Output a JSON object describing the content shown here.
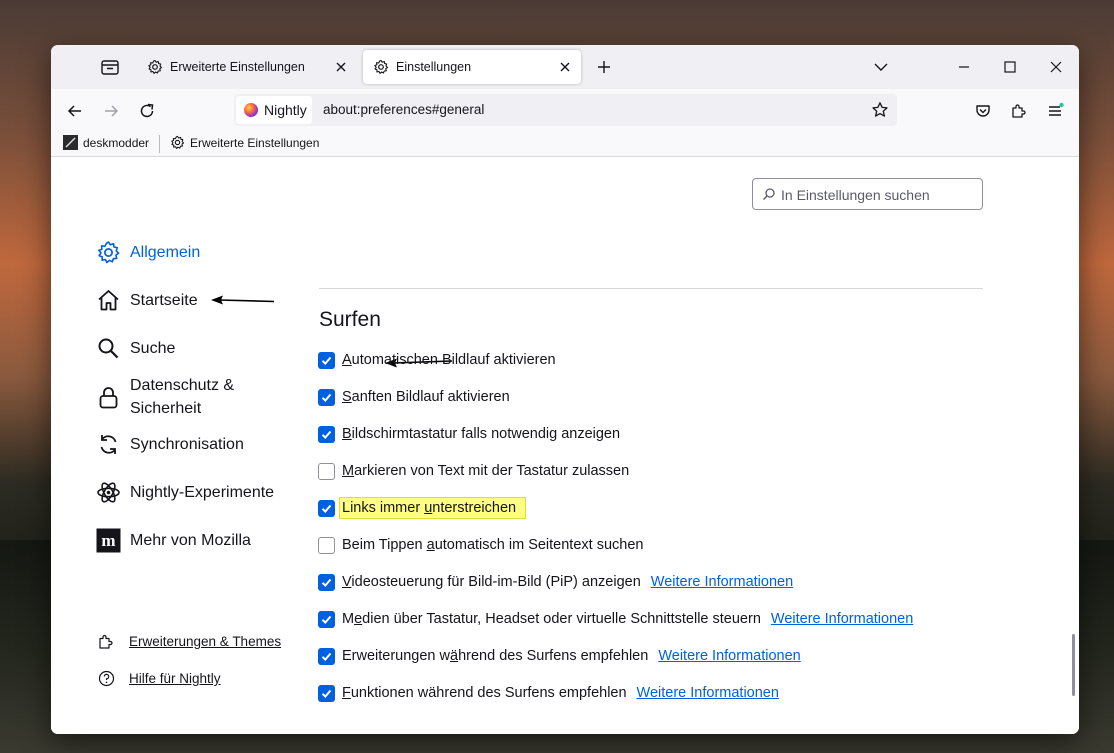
{
  "tabs": [
    {
      "label": "Erweiterte Einstellungen",
      "icon": "gear-icon"
    },
    {
      "label": "Einstellungen",
      "icon": "gear-icon",
      "active": true
    }
  ],
  "urlbar": {
    "identity": "Nightly",
    "url": "about:preferences#general"
  },
  "bookmarks": [
    {
      "label": "deskmodder",
      "icon": "deskmodder-icon"
    },
    {
      "label": "Erweiterte Einstellungen",
      "icon": "gear-icon"
    }
  ],
  "search": {
    "placeholder": "In Einstellungen suchen"
  },
  "sidebar": {
    "categories": [
      {
        "label": "Allgemein",
        "icon": "gear-icon",
        "selected": true
      },
      {
        "label": "Startseite",
        "icon": "home-icon"
      },
      {
        "label": "Suche",
        "icon": "search-icon"
      },
      {
        "label": "Datenschutz & Sicherheit",
        "icon": "lock-icon"
      },
      {
        "label": "Synchronisation",
        "icon": "sync-icon"
      },
      {
        "label": "Nightly-Experimente",
        "icon": "atom-icon"
      },
      {
        "label": "Mehr von Mozilla",
        "icon": "mozilla-icon"
      }
    ],
    "links": [
      {
        "label": "Erweiterungen & Themes",
        "icon": "puzzle-icon"
      },
      {
        "label": "Hilfe für Nightly",
        "icon": "help-icon"
      }
    ]
  },
  "section": {
    "title": "Surfen",
    "more_label": "Weitere Informationen",
    "options": [
      {
        "pre": "",
        "u": "A",
        "post": "utomatischen Bildlauf aktivieren",
        "checked": true
      },
      {
        "pre": "",
        "u": "S",
        "post": "anften Bildlauf aktivieren",
        "checked": true
      },
      {
        "pre": "",
        "u": "B",
        "post": "ildschirmtastatur falls notwendig anzeigen",
        "checked": true
      },
      {
        "pre": "",
        "u": "M",
        "post": "arkieren von Text mit der Tastatur zulassen",
        "checked": false
      },
      {
        "pre": "Links immer ",
        "u": "u",
        "post": "nterstreichen",
        "checked": true,
        "highlighted": true
      },
      {
        "pre": "Beim Tippen ",
        "u": "a",
        "post": "utomatisch im Seitentext suchen",
        "checked": false
      },
      {
        "pre": "",
        "u": "V",
        "post": "ideosteuerung für Bild-im-Bild (PiP) anzeigen",
        "checked": true,
        "more": true
      },
      {
        "pre": "M",
        "u": "e",
        "post": "dien über Tastatur, Headset oder virtuelle Schnittstelle steuern",
        "checked": true,
        "more": true
      },
      {
        "pre": "Erweiterungen w",
        "u": "ä",
        "post": "hrend des Surfens empfehlen",
        "checked": true,
        "more": true
      },
      {
        "pre": "",
        "u": "F",
        "post": "unktionen während des Surfens empfehlen",
        "checked": true,
        "more": true
      }
    ]
  },
  "colors": {
    "accent": "#0061e0",
    "highlight": "#fffe80"
  }
}
